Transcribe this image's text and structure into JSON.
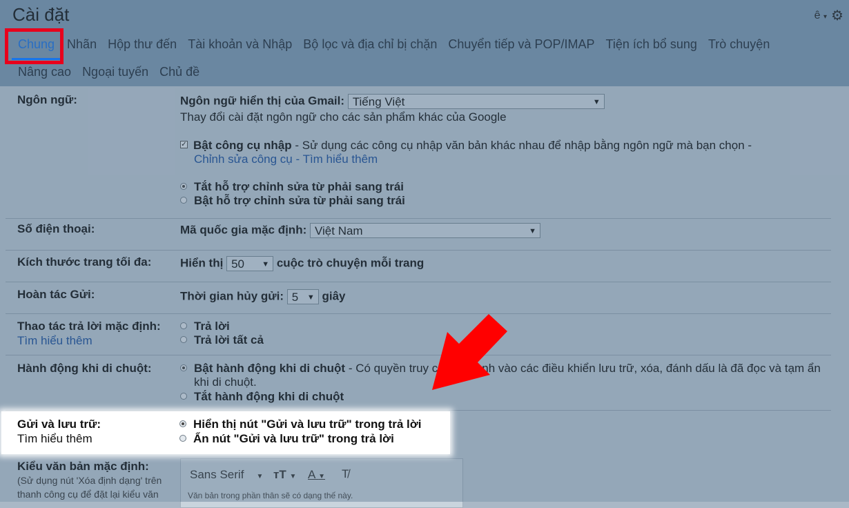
{
  "title": "Cài đặt",
  "header": {
    "account_letter": "ê"
  },
  "tabs_row1": [
    "Chung",
    "Nhãn",
    "Hộp thư đến",
    "Tài khoản và Nhập",
    "Bộ lọc và địa chỉ bị chặn",
    "Chuyển tiếp và POP/IMAP",
    "Tiện ích bổ sung",
    "Trò chuyện"
  ],
  "tabs_row2": [
    "Nâng cao",
    "Ngoại tuyến",
    "Chủ đề"
  ],
  "settings": {
    "language": {
      "label": "Ngôn ngữ:",
      "display_label": "Ngôn ngữ hiển thị của Gmail:",
      "display_value": "Tiếng Việt",
      "change_link": "Thay đổi cài đặt ngôn ngữ cho các sản phẩm khác của Google",
      "input_tools_label": "Bật công cụ nhập",
      "input_tools_desc": " - Sử dụng các công cụ nhập văn bản khác nhau để nhập bằng ngôn ngữ mà bạn chọn -",
      "edit_tools_link": "Chỉnh sửa công cụ",
      "sep": " - ",
      "learn_more": "Tìm hiểu thêm",
      "rtl_off": "Tắt hỗ trợ chỉnh sửa từ phải sang trái",
      "rtl_on": "Bật hỗ trợ chỉnh sửa từ phải sang trái"
    },
    "phone": {
      "label": "Số điện thoại:",
      "country_label": "Mã quốc gia mặc định:",
      "country_value": "Việt Nam"
    },
    "page_size": {
      "label": "Kích thước trang tối đa:",
      "prefix": "Hiển thị",
      "value": "50",
      "suffix": "cuộc trò chuyện mỗi trang"
    },
    "undo_send": {
      "label": "Hoàn tác Gửi:",
      "prefix": "Thời gian hủy gửi:",
      "value": "5",
      "suffix": "giây"
    },
    "reply": {
      "label": "Thao tác trả lời mặc định:",
      "learn_more": "Tìm hiểu thêm",
      "opt1": "Trả lời",
      "opt2": "Trả lời tất cả"
    },
    "hover": {
      "label": "Hành động khi di chuột:",
      "opt1_label": "Bật hành động khi di chuột",
      "opt1_desc": " - Có quyền truy c",
      "opt1_desc_tail": "nh vào các điều khiển lưu trữ, xóa, đánh dấu là đã đọc và tạm ẩn",
      "opt1_desc_line2": "khi di chuột.",
      "opt2_label": "Tắt hành động khi di chuột"
    },
    "send_archive": {
      "label": "Gửi và lưu trữ:",
      "learn_more": "Tìm hiểu thêm",
      "opt1": "Hiển thị nút \"Gửi và lưu trữ\" trong trả lời",
      "opt2": "Ẩn nút \"Gửi và lưu trữ\" trong trả lời"
    },
    "default_text": {
      "label": "Kiểu văn bản mặc định:",
      "desc_line1": "(Sử dụng nút 'Xóa định dạng' trên",
      "desc_line2": "thanh công cụ để đặt lại kiểu văn",
      "font": "Sans Serif",
      "preview": "Văn bản trong phần thân sẽ có dạng thế này."
    }
  },
  "colors": {
    "highlight_border": "#e8001c",
    "arrow": "#ff0000",
    "link": "#1a4e9c",
    "active_tab": "#1a73e8"
  }
}
